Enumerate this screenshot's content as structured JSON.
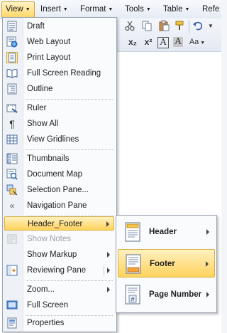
{
  "menubar": {
    "items": [
      {
        "label": "View"
      },
      {
        "label": "Insert"
      },
      {
        "label": "Format"
      },
      {
        "label": "Tools"
      },
      {
        "label": "Table"
      },
      {
        "label": "Refe"
      }
    ]
  },
  "toolbar": {
    "buttons": [
      "cut-icon",
      "copy-icon",
      "paste-icon",
      "format-painter-icon",
      "undo-icon",
      "redo-icon"
    ],
    "row2": {
      "subscript": "x₂",
      "superscript": "x²",
      "char_a": "A",
      "char_a_shaded": "A",
      "font_size_label": "Aa"
    }
  },
  "menu": {
    "items": [
      {
        "label": "Draft",
        "icon": "draft-icon"
      },
      {
        "label": "Web Layout",
        "icon": "web-layout-icon"
      },
      {
        "label": "Print Layout",
        "icon": "print-layout-icon",
        "checked": true
      },
      {
        "label": "Full Screen Reading",
        "icon": "full-screen-reading-icon"
      },
      {
        "label": "Outline",
        "icon": "outline-icon"
      },
      {
        "label": "Ruler",
        "icon": "ruler-icon"
      },
      {
        "label": "Show All",
        "icon": "pilcrow-icon"
      },
      {
        "label": "View Gridlines",
        "icon": "gridlines-icon"
      },
      {
        "label": "Thumbnails",
        "icon": "thumbnails-icon"
      },
      {
        "label": "Document Map",
        "icon": "document-map-icon"
      },
      {
        "label": "Selection Pane...",
        "icon": "selection-pane-icon"
      },
      {
        "label": "Navigation Pane",
        "icon": "navigation-pane-icon"
      },
      {
        "label": "Header_Footer",
        "selected": true
      },
      {
        "label": "Show Notes",
        "disabled": true,
        "icon": "show-notes-icon"
      },
      {
        "label": "Show Markup"
      },
      {
        "label": "Reviewing Pane",
        "icon": "reviewing-pane-icon"
      },
      {
        "label": "Zoom..."
      },
      {
        "label": "Full Screen",
        "icon": "full-screen-icon"
      },
      {
        "label": "Properties",
        "icon": "properties-icon"
      }
    ]
  },
  "submenu": {
    "items": [
      {
        "label": "Header",
        "icon": "header-icon"
      },
      {
        "label": "Footer",
        "icon": "footer-icon",
        "selected": true
      },
      {
        "label": "Page Number",
        "icon": "page-number-icon"
      }
    ],
    "page_number_glyph": "#"
  },
  "colors": {
    "highlight": "#ffd25c",
    "highlight_border": "#d9ae3f",
    "menu_border": "#9aa4b3",
    "disabled_text": "#9a9fa8"
  }
}
